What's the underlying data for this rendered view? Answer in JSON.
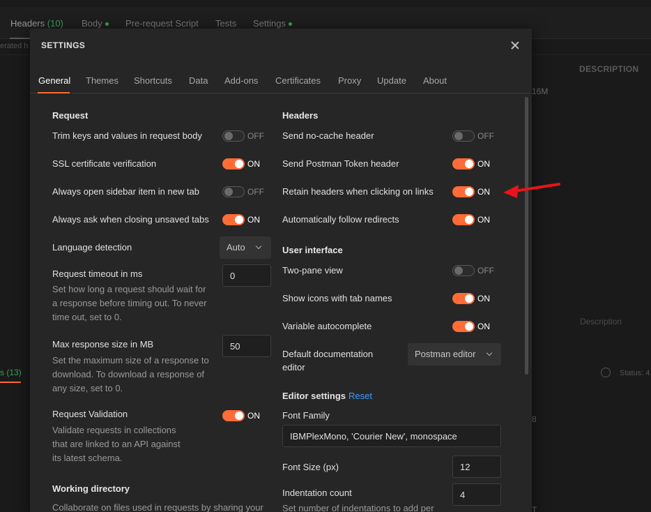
{
  "background": {
    "tabs": [
      {
        "label": "Headers",
        "count": "(10)"
      },
      {
        "label": "Body",
        "dot": true
      },
      {
        "label": "Pre-request Script"
      },
      {
        "label": "Tests"
      },
      {
        "label": "Settings",
        "dot": true
      }
    ],
    "left_snippet": "erated h",
    "description_header": "DESCRIPTION",
    "snippet_16m": "16M",
    "description_placeholder": "Description",
    "response_tab_suffix": "s",
    "response_count": "(13)",
    "status_label": "Status: 4",
    "snippet_8": "8",
    "snippet_t": "T"
  },
  "modal": {
    "title": "SETTINGS",
    "tabs": [
      "General",
      "Themes",
      "Shortcuts",
      "Data",
      "Add-ons",
      "Certificates",
      "Proxy",
      "Update",
      "About"
    ],
    "active_tab": "General"
  },
  "left": {
    "request_heading": "Request",
    "trim_label": "Trim keys and values in request body",
    "trim_state": "OFF",
    "ssl_label": "SSL certificate verification",
    "ssl_state": "ON",
    "sidebar_label": "Always open sidebar item in new tab",
    "sidebar_state": "OFF",
    "ask_label": "Always ask when closing unsaved tabs",
    "ask_state": "ON",
    "lang_label": "Language detection",
    "lang_value": "Auto",
    "timeout_label": "Request timeout in ms",
    "timeout_help_1": "Set how long a request should wait for",
    "timeout_help_2": "a response before timing out. To never",
    "timeout_help_3": "time out, set to 0.",
    "timeout_value": "0",
    "maxsize_label": "Max response size in MB",
    "maxsize_help_1": "Set the maximum size of a response to",
    "maxsize_help_2": "download. To download a response of",
    "maxsize_help_3": "any size, set to 0.",
    "maxsize_value": "50",
    "validation_label": "Request Validation",
    "validation_state": "ON",
    "validation_help_1": "Validate requests in collections",
    "validation_help_2": "that are linked to an API against",
    "validation_help_3": "its latest schema.",
    "workdir_heading": "Working directory",
    "workdir_help_1": "Collaborate on files used in requests by sharing your"
  },
  "right": {
    "headers_heading": "Headers",
    "nocache_label": "Send no-cache header",
    "nocache_state": "OFF",
    "token_label": "Send Postman Token header",
    "token_state": "ON",
    "retain_label": "Retain headers when clicking on links",
    "retain_state": "ON",
    "redirect_label": "Automatically follow redirects",
    "redirect_state": "ON",
    "ui_heading": "User interface",
    "twopane_label": "Two-pane view",
    "twopane_state": "OFF",
    "icons_label": "Show icons with tab names",
    "icons_state": "ON",
    "autocomplete_label": "Variable autocomplete",
    "autocomplete_state": "ON",
    "doceditor_label_1": "Default documentation",
    "doceditor_label_2": "editor",
    "doceditor_value": "Postman editor",
    "editor_heading": "Editor settings",
    "reset_label": "Reset",
    "font_family_label": "Font Family",
    "font_family_value": "IBMPlexMono, 'Courier New', monospace",
    "font_size_label": "Font Size (px)",
    "font_size_value": "12",
    "indent_label": "Indentation count",
    "indent_value": "4",
    "indent_help_1": "Set number of indentations to add per"
  },
  "colors": {
    "accent": "#ff6c37",
    "link": "#3d9bff",
    "annotation_arrow": "#e8141b"
  }
}
